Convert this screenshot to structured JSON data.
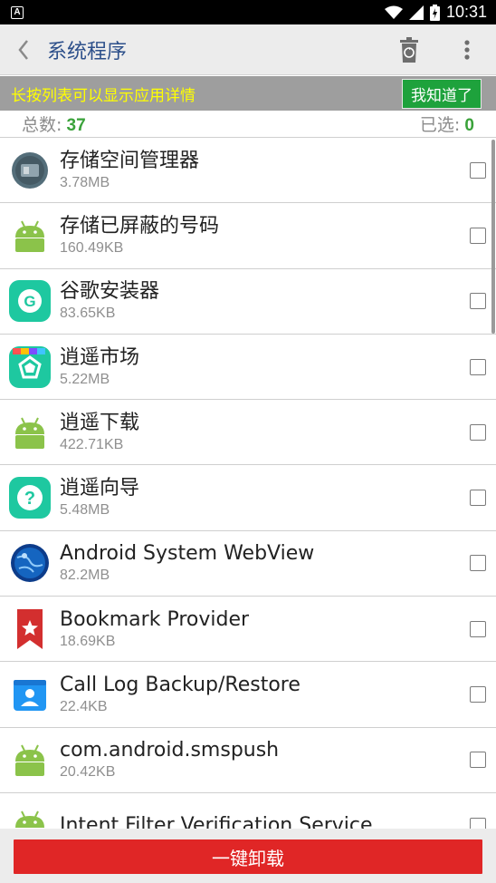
{
  "status_bar": {
    "time": "10:31",
    "notification_icon": "A"
  },
  "toolbar": {
    "title": "系统程序",
    "back_icon": "chevron-left-icon",
    "actions": [
      "recycle-bin-icon",
      "more-vert-icon"
    ]
  },
  "hint": {
    "text": "长按列表可以显示应用详情",
    "button": "我知道了"
  },
  "counts": {
    "total_label": "总数:",
    "total_value": "37",
    "selected_label": "已选:",
    "selected_value": "0"
  },
  "apps": [
    {
      "name": "存储空间管理器",
      "size": "3.78MB",
      "icon": "storage-manager-icon"
    },
    {
      "name": "存储已屏蔽的号码",
      "size": "160.49KB",
      "icon": "android-icon"
    },
    {
      "name": "谷歌安装器",
      "size": "83.65KB",
      "icon": "google-installer-icon"
    },
    {
      "name": "逍遥市场",
      "size": "5.22MB",
      "icon": "xiaoyao-market-icon"
    },
    {
      "name": "逍遥下载",
      "size": "422.71KB",
      "icon": "android-icon"
    },
    {
      "name": "逍遥向导",
      "size": "5.48MB",
      "icon": "xiaoyao-guide-icon"
    },
    {
      "name": "Android System WebView",
      "size": "82.2MB",
      "icon": "globe-icon"
    },
    {
      "name": "Bookmark Provider",
      "size": "18.69KB",
      "icon": "bookmark-icon"
    },
    {
      "name": "Call Log Backup/Restore",
      "size": "22.4KB",
      "icon": "contacts-icon"
    },
    {
      "name": "com.android.smspush",
      "size": "20.42KB",
      "icon": "android-icon"
    },
    {
      "name": "Intent Filter Verification Service",
      "size": "",
      "icon": "android-icon"
    }
  ],
  "bottom": {
    "uninstall_label": "一键卸载"
  },
  "colors": {
    "accent_red": "#e02626",
    "hint_yellow": "#ffff00",
    "green": "#1ea23c",
    "title_blue": "#2c4f8a"
  }
}
